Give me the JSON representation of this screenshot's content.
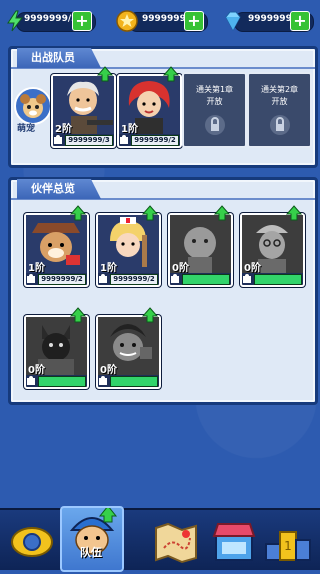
{
  "resources": [
    {
      "name": "energy",
      "value": "9999999/20",
      "icon": "lightning-icon"
    },
    {
      "name": "coins",
      "value": "9999999",
      "icon": "star-coin-icon"
    },
    {
      "name": "gems",
      "value": "9999999",
      "icon": "diamond-icon"
    }
  ],
  "lineup": {
    "title": "出战队员",
    "pet_label": "萌宠",
    "members": [
      {
        "stage": "2阶",
        "progress": "9999999/3"
      },
      {
        "stage": "1阶",
        "progress": "9999999/2"
      }
    ],
    "locked_slots": [
      {
        "line1": "通关第1章",
        "line2": "开放"
      },
      {
        "line1": "通关第2章",
        "line2": "开放"
      }
    ]
  },
  "roster": {
    "title": "伙伴总览",
    "heroes": [
      {
        "stage": "1阶",
        "progress": "9999999/2"
      },
      {
        "stage": "1阶",
        "progress": "9999999/2"
      },
      {
        "stage": "0阶",
        "progress": ""
      },
      {
        "stage": "0阶",
        "progress": ""
      },
      {
        "stage": "0阶",
        "progress": ""
      },
      {
        "stage": "0阶",
        "progress": ""
      }
    ]
  },
  "nav": {
    "active_label": "队伍",
    "items": [
      "shield-icon",
      "team-icon",
      "map-icon",
      "shop-icon",
      "ranking-icon"
    ]
  },
  "colors": {
    "accent": "#36c235",
    "panel": "#dfe9f6",
    "border": "#163a7c",
    "nav": "#1a3a7d"
  }
}
